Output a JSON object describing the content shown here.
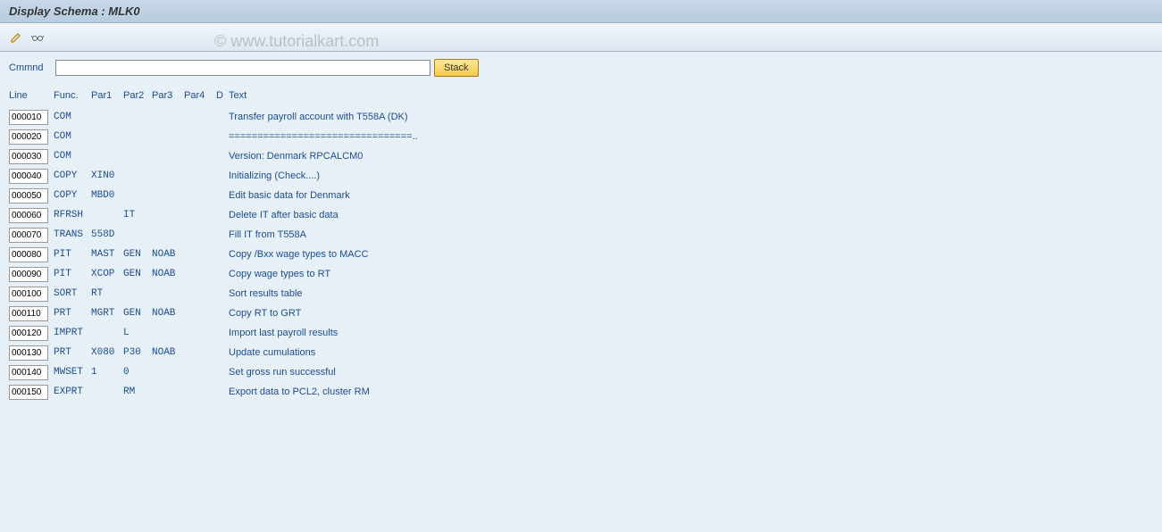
{
  "title": "Display Schema : MLK0",
  "watermark": "© www.tutorialkart.com",
  "cmd": {
    "label": "Cmmnd",
    "value": "",
    "stack_label": "Stack"
  },
  "headers": {
    "line": "Line",
    "func": "Func.",
    "par1": "Par1",
    "par2": "Par2",
    "par3": "Par3",
    "par4": "Par4",
    "d": "D",
    "text": "Text"
  },
  "rows": [
    {
      "line": "000010",
      "func": "COM",
      "par1": "",
      "par2": "",
      "par3": "",
      "par4": "",
      "d": "",
      "text": "Transfer payroll account with T558A (DK)"
    },
    {
      "line": "000020",
      "func": "COM",
      "par1": "",
      "par2": "",
      "par3": "",
      "par4": "",
      "d": "",
      "text": "================================.."
    },
    {
      "line": "000030",
      "func": "COM",
      "par1": "",
      "par2": "",
      "par3": "",
      "par4": "",
      "d": "",
      "text": "Version: Denmark RPCALCM0"
    },
    {
      "line": "000040",
      "func": "COPY",
      "par1": "XIN0",
      "par2": "",
      "par3": "",
      "par4": "",
      "d": "",
      "text": "Initializing (Check....)"
    },
    {
      "line": "000050",
      "func": "COPY",
      "par1": "MBD0",
      "par2": "",
      "par3": "",
      "par4": "",
      "d": "",
      "text": "Edit basic data for Denmark"
    },
    {
      "line": "000060",
      "func": "RFRSH",
      "par1": "",
      "par2": "IT",
      "par3": "",
      "par4": "",
      "d": "",
      "text": "Delete IT after basic data"
    },
    {
      "line": "000070",
      "func": "TRANS",
      "par1": "558D",
      "par2": "",
      "par3": "",
      "par4": "",
      "d": "",
      "text": "Fill IT from T558A"
    },
    {
      "line": "000080",
      "func": "PIT",
      "par1": "MAST",
      "par2": "GEN",
      "par3": "NOAB",
      "par4": "",
      "d": "",
      "text": "Copy /Bxx wage types to MACC"
    },
    {
      "line": "000090",
      "func": "PIT",
      "par1": "XCOP",
      "par2": "GEN",
      "par3": "NOAB",
      "par4": "",
      "d": "",
      "text": "Copy wage types to RT"
    },
    {
      "line": "000100",
      "func": "SORT",
      "par1": "RT",
      "par2": "",
      "par3": "",
      "par4": "",
      "d": "",
      "text": "Sort results table"
    },
    {
      "line": "000110",
      "func": "PRT",
      "par1": "MGRT",
      "par2": "GEN",
      "par3": "NOAB",
      "par4": "",
      "d": "",
      "text": "Copy RT to GRT"
    },
    {
      "line": "000120",
      "func": "IMPRT",
      "par1": "",
      "par2": "L",
      "par3": "",
      "par4": "",
      "d": "",
      "text": "Import last payroll results"
    },
    {
      "line": "000130",
      "func": "PRT",
      "par1": "X080",
      "par2": "P30",
      "par3": "NOAB",
      "par4": "",
      "d": "",
      "text": "Update cumulations"
    },
    {
      "line": "000140",
      "func": "MWSET",
      "par1": "1",
      "par2": "0",
      "par3": "",
      "par4": "",
      "d": "",
      "text": "Set gross run successful"
    },
    {
      "line": "000150",
      "func": "EXPRT",
      "par1": "",
      "par2": "RM",
      "par3": "",
      "par4": "",
      "d": "",
      "text": "Export data to PCL2, cluster RM"
    }
  ]
}
